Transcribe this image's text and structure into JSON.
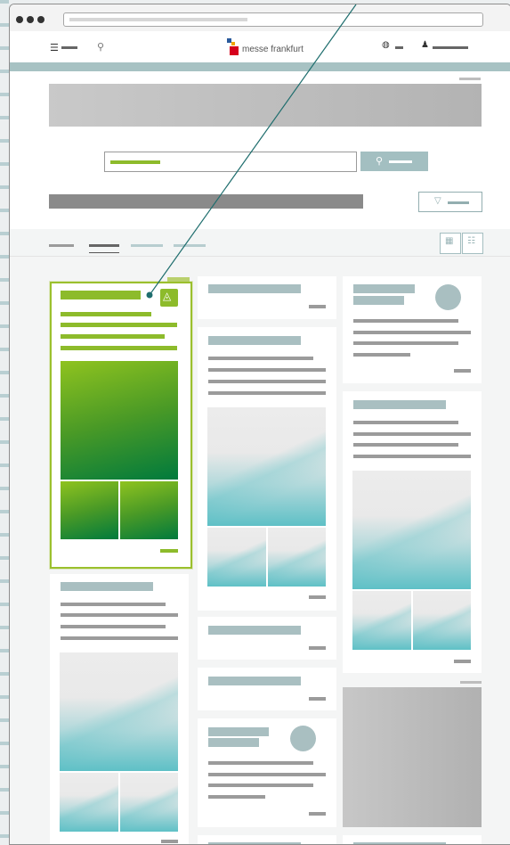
{
  "brand": {
    "name": "messe frankfurt"
  },
  "icons": {
    "menu": "☰",
    "search": "⚲",
    "language": "◍",
    "user": "♟",
    "filter": "▽",
    "grid_view": "▦",
    "list_view": "☷",
    "featured_badge": "◬"
  },
  "colors": {
    "accent_green": "#8dbb2b",
    "teal": "#a3bfc1",
    "placeholder_gray": "#9b9b9b"
  }
}
